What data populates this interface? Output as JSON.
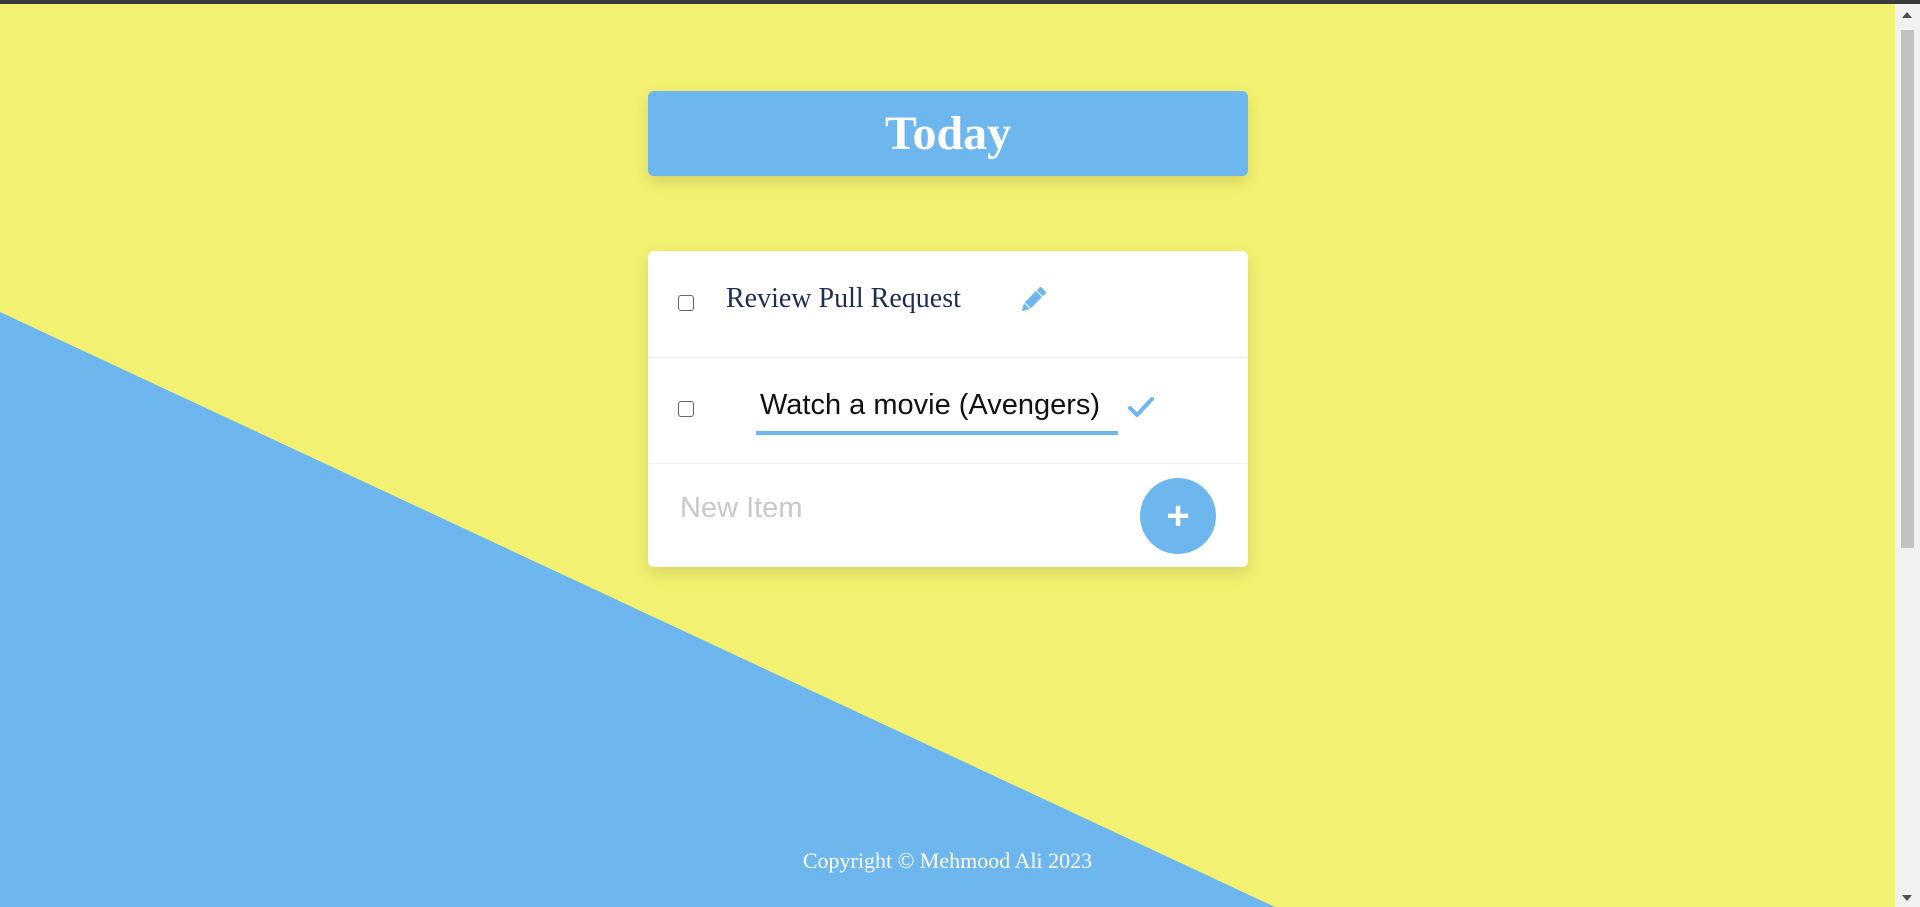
{
  "colors": {
    "background_yellow": "#f2f171",
    "accent_blue": "#6db6ee",
    "text_dark_navy": "#1f2d52",
    "white": "#ffffff"
  },
  "header": {
    "title": "Today"
  },
  "todo_list": {
    "items": [
      {
        "label": "Review Pull Request",
        "checked": false,
        "editing": false,
        "action_icon": "pencil-icon"
      },
      {
        "label": "Watch a movie (Avengers)",
        "checked": false,
        "editing": true,
        "action_icon": "check-icon"
      }
    ],
    "new_item": {
      "placeholder": "New Item",
      "value": "",
      "add_button_label": "+"
    }
  },
  "footer": {
    "text": "Copyright © Mehmood Ali 2023"
  }
}
